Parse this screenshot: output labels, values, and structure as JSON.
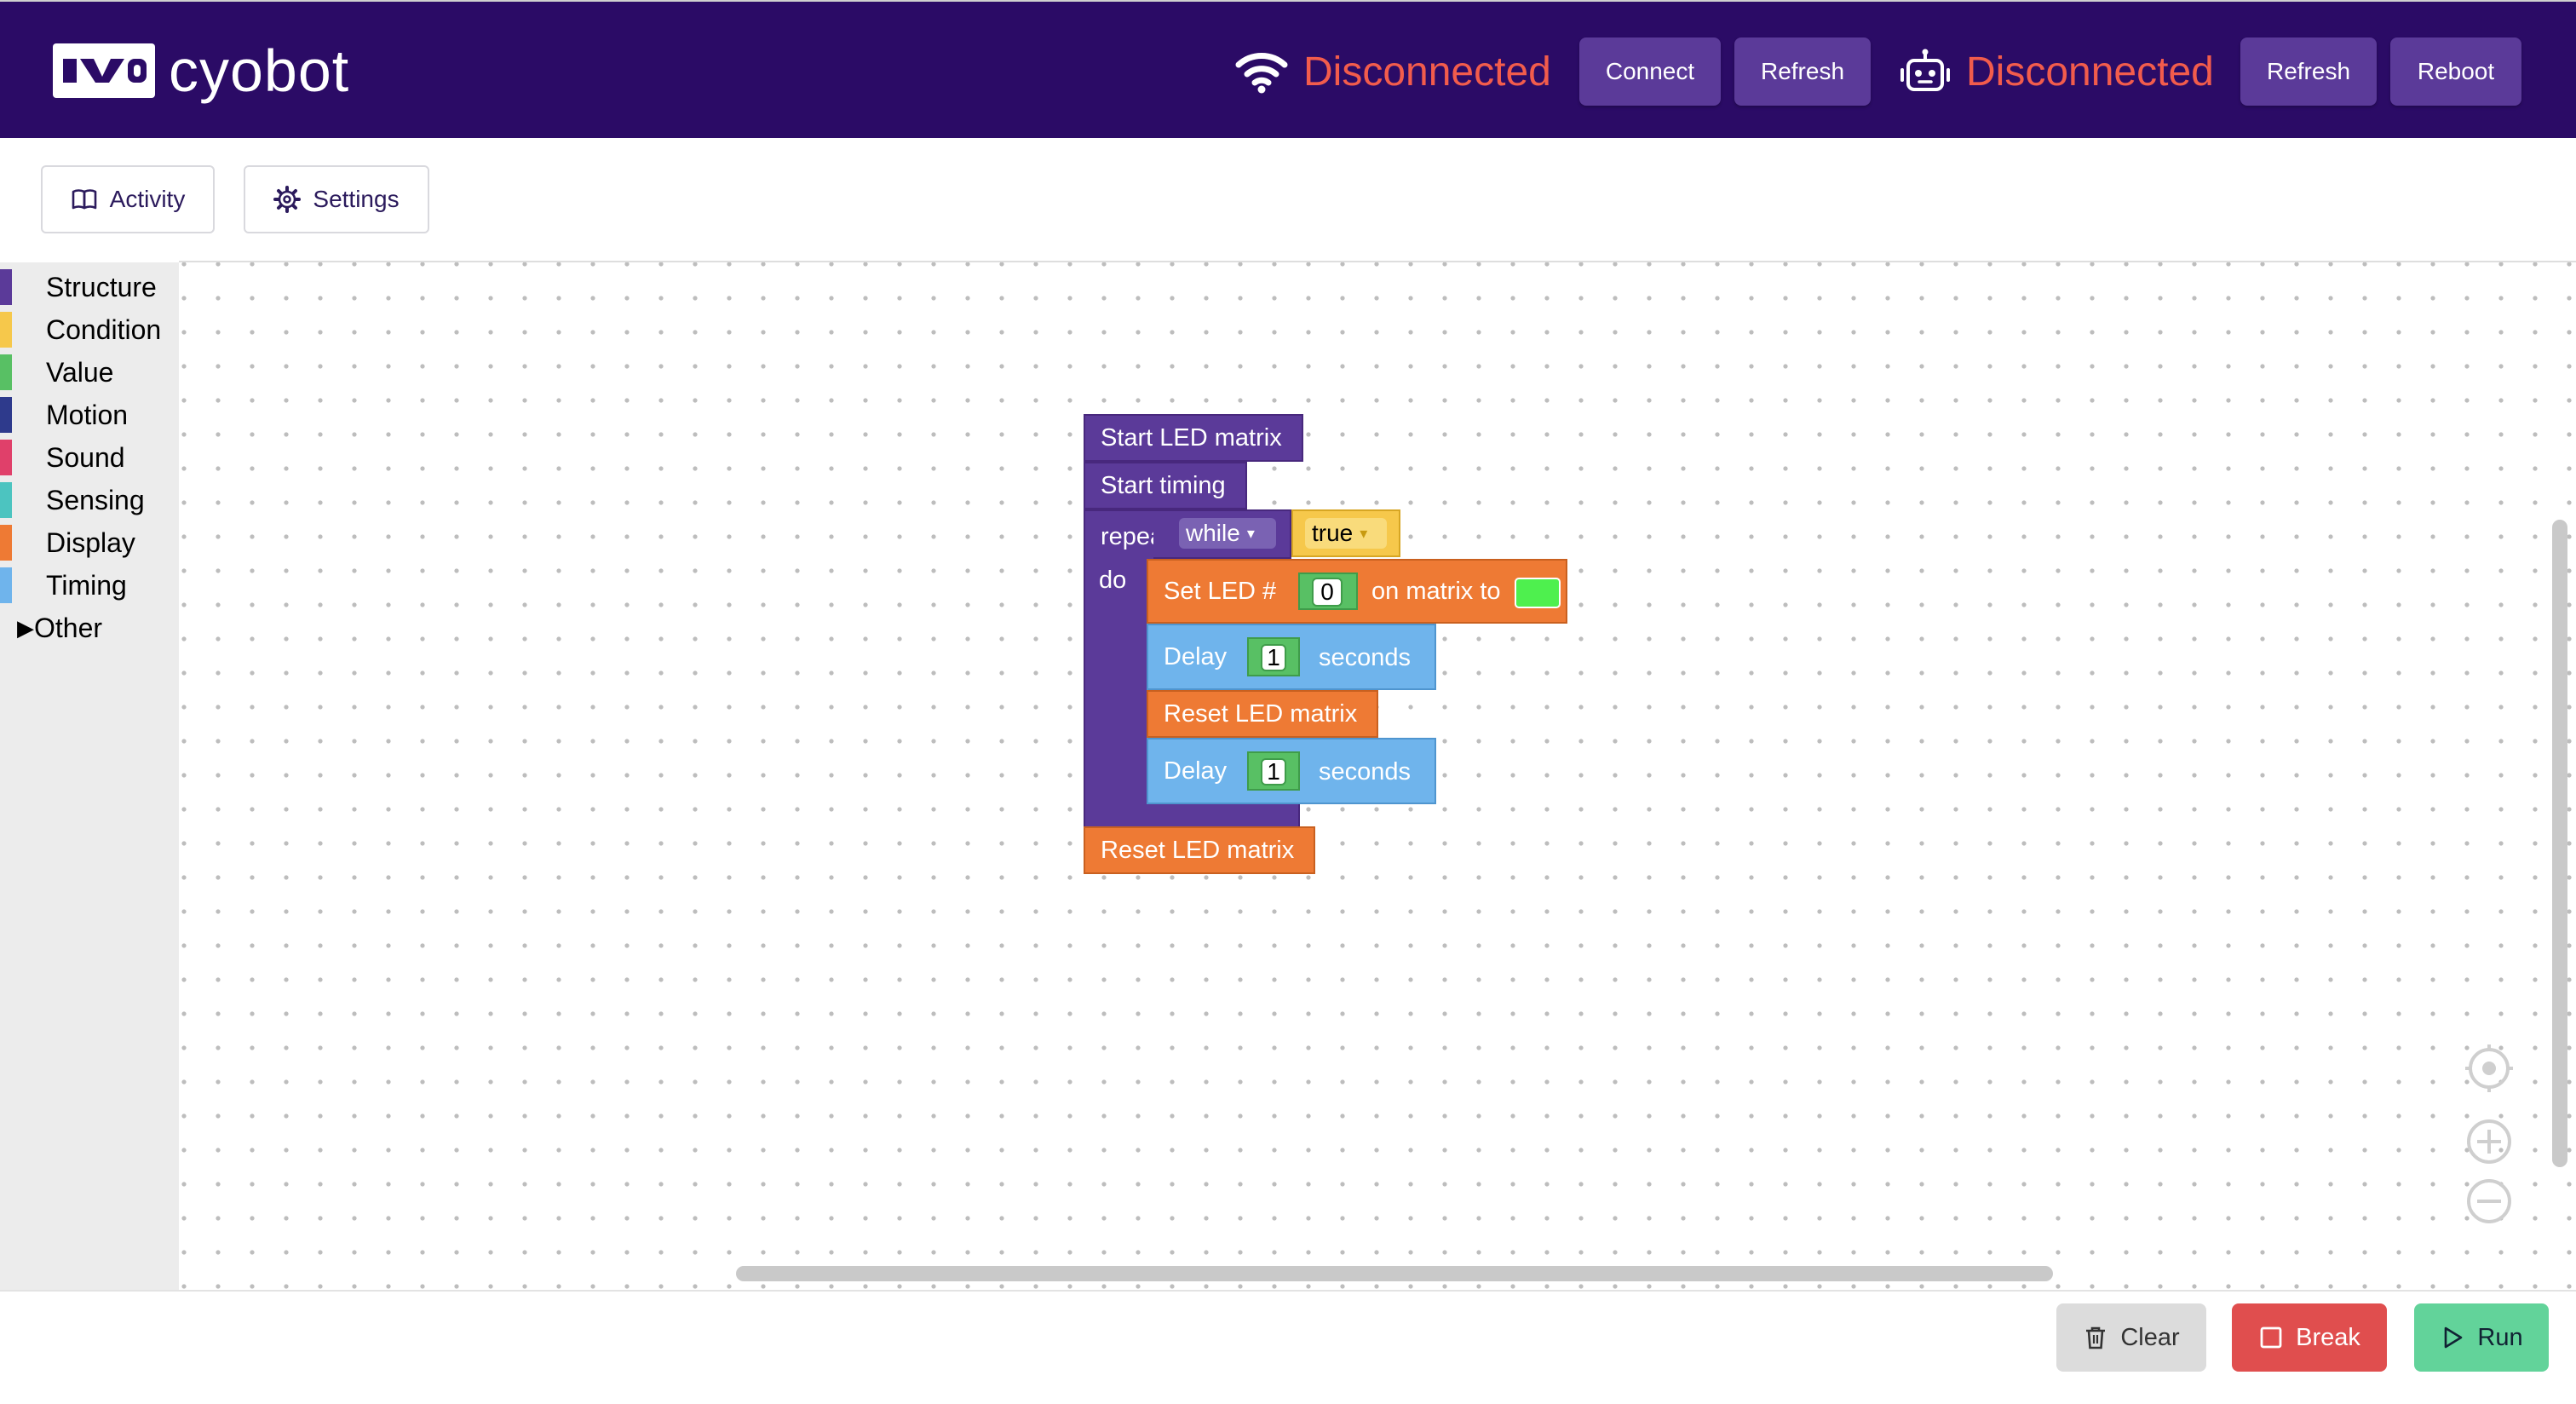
{
  "app": {
    "brand": "cyobot"
  },
  "header": {
    "wifi_status": "Disconnected",
    "robot_status": "Disconnected",
    "connect_label": "Connect",
    "refresh_label_1": "Refresh",
    "refresh_label_2": "Refresh",
    "reboot_label": "Reboot",
    "status_color": "#f25c4c",
    "bg_color": "#2b0b66"
  },
  "toolbar": {
    "activity_label": "Activity",
    "settings_label": "Settings"
  },
  "toolbox": {
    "categories": [
      {
        "label": "Structure",
        "color": "#5b3a99"
      },
      {
        "label": "Condition",
        "color": "#f6c84b"
      },
      {
        "label": "Value",
        "color": "#58c064"
      },
      {
        "label": "Motion",
        "color": "#2e3a8c"
      },
      {
        "label": "Sound",
        "color": "#e0406a"
      },
      {
        "label": "Sensing",
        "color": "#4cc4c0"
      },
      {
        "label": "Display",
        "color": "#ee7a34"
      },
      {
        "label": "Timing",
        "color": "#6fb4ec"
      },
      {
        "label": "Other",
        "color": ""
      }
    ]
  },
  "program": {
    "start_led": "Start LED matrix",
    "start_timing": "Start timing",
    "repeat": "repeat",
    "repeat_mode": "while",
    "condition": "true",
    "do": "do",
    "set_led": "Set LED #",
    "led_index": "0",
    "on_matrix_to": "on matrix to",
    "led_color": "#4ef04e",
    "delay_1": "Delay",
    "delay_1_value": "1",
    "seconds_1": "seconds",
    "reset_inner": "Reset LED matrix",
    "delay_2": "Delay",
    "delay_2_value": "1",
    "seconds_2": "seconds",
    "reset_final": "Reset LED matrix"
  },
  "footer": {
    "clear_label": "Clear",
    "break_label": "Break",
    "run_label": "Run"
  }
}
